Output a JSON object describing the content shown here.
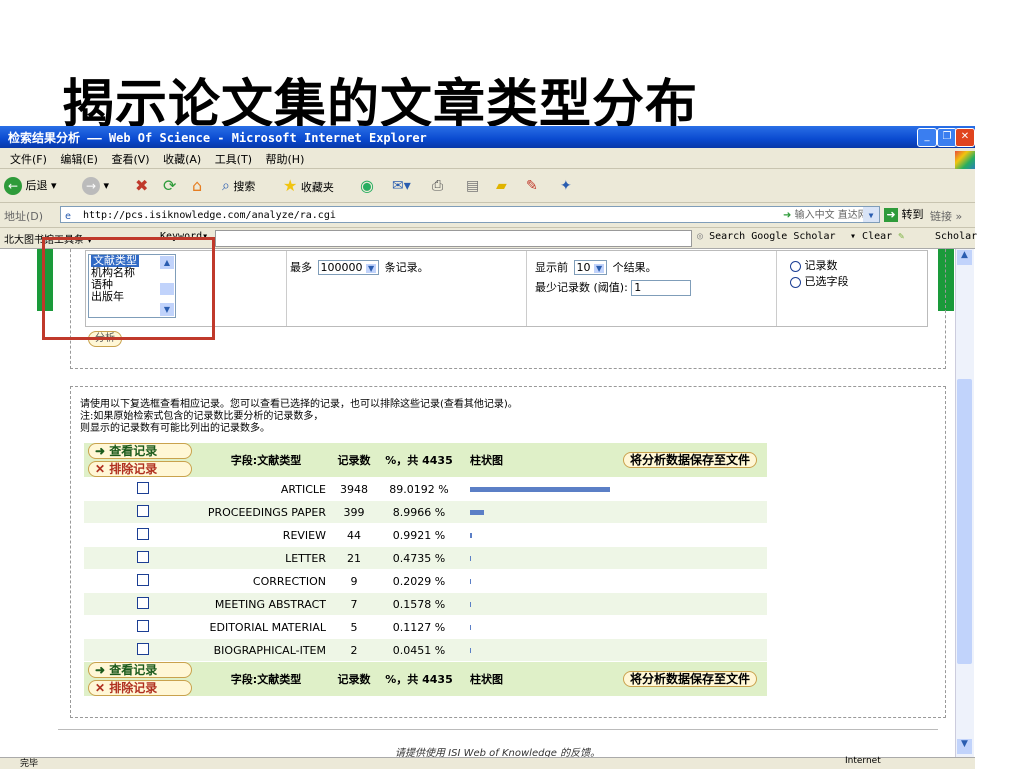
{
  "slide_title": "揭示论文集的文章类型分布",
  "window": {
    "title": "检索结果分析 —— Web Of Science - Microsoft Internet Explorer"
  },
  "menu": [
    "文件(F)",
    "编辑(E)",
    "查看(V)",
    "收藏(A)",
    "工具(T)",
    "帮助(H)"
  ],
  "toolbar": {
    "back": "后退",
    "search": "搜索",
    "favorites": "收藏夹"
  },
  "address": {
    "label": "地址(D)",
    "url": "http://pcs.isiknowledge.com/analyze/ra.cgi",
    "input_hint": "输入中文 直达网站",
    "go": "转到",
    "links": "链接"
  },
  "google_bar": {
    "library_tools": "北大图书馆工具条",
    "keyword": "Keyword",
    "search_scholar": "Search Google Scholar",
    "clear": "Clear",
    "scholar": "Scholar"
  },
  "analysis": {
    "field_options": [
      "文献类型",
      "机构名称",
      "语种",
      "出版年"
    ],
    "max_label": "最多",
    "max_value": "100000",
    "records_suffix": "条记录。",
    "show_top_label": "显示前",
    "show_top_value": "10",
    "results_suffix": "个结果。",
    "min_records_label": "最少记录数 (阈值):",
    "min_records_value": "1",
    "sort_options": [
      "记录数",
      "已选字段"
    ],
    "analyze_button": "分析"
  },
  "results": {
    "instruction": [
      "请使用以下复选框查看相应记录。您可以查看已选择的记录，也可以排除这些记录(查看其他记录)。",
      "注:如果原始检索式包含的记录数比要分析的记录数多，",
      "则显示的记录数有可能比列出的记录数多。"
    ],
    "view_button": "➜ 查看记录",
    "exclude_button": "✕ 排除记录",
    "col_field": "字段:文献类型",
    "col_count": "记录数",
    "col_pct": "%，共 4435",
    "col_chart": "柱状图",
    "save_button": "将分析数据保存至文件",
    "rows": [
      {
        "type": "ARTICLE",
        "count": "3948",
        "pct": "89.0192 %",
        "bar": 0.890192
      },
      {
        "type": "PROCEEDINGS PAPER",
        "count": "399",
        "pct": "8.9966 %",
        "bar": 0.089966
      },
      {
        "type": "REVIEW",
        "count": "44",
        "pct": "0.9921 %",
        "bar": 0.009921
      },
      {
        "type": "LETTER",
        "count": "21",
        "pct": "0.4735 %",
        "bar": 0.004735
      },
      {
        "type": "CORRECTION",
        "count": "9",
        "pct": "0.2029 %",
        "bar": 0.002029
      },
      {
        "type": "MEETING ABSTRACT",
        "count": "7",
        "pct": "0.1578 %",
        "bar": 0.001578
      },
      {
        "type": "EDITORIAL MATERIAL",
        "count": "5",
        "pct": "0.1127 %",
        "bar": 0.001127
      },
      {
        "type": "BIOGRAPHICAL-ITEM",
        "count": "2",
        "pct": "0.0451 %",
        "bar": 0.000451
      }
    ]
  },
  "footer": {
    "feedback": "请提供使用 ISI Web of Knowledge 的反馈。"
  },
  "status": {
    "text": "完毕",
    "zone": "Internet"
  }
}
